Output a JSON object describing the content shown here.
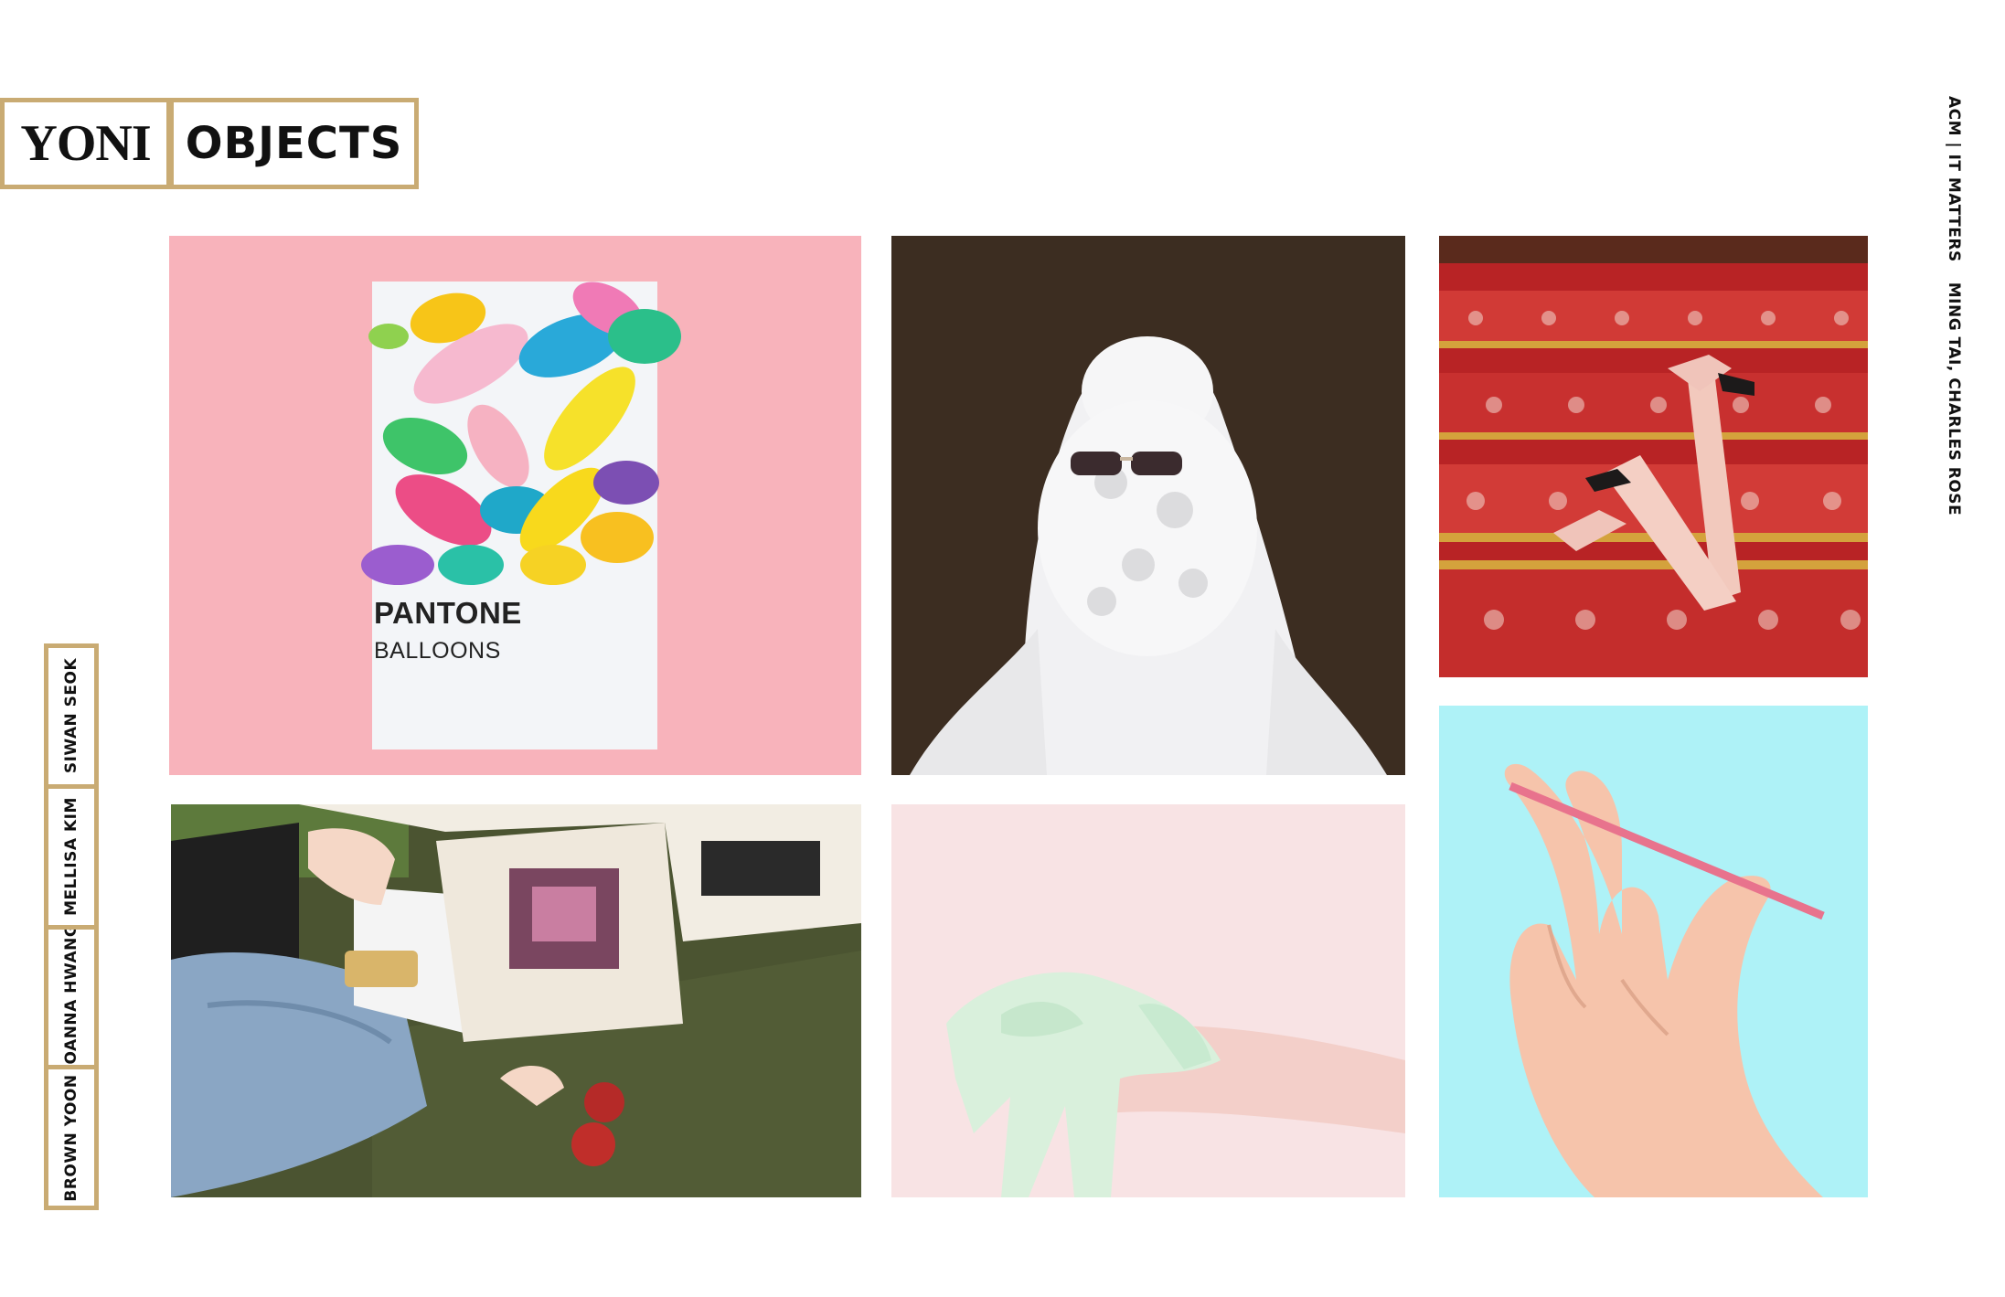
{
  "header": {
    "brand": "YONI",
    "section": "OBJECTS"
  },
  "authors": [
    "SIWAN SEOK",
    "MELLISA KIM",
    "JOANNA HWANG",
    "BROWN YOON"
  ],
  "credits": [
    "ACM | IT MATTERS",
    "MING TAI, CHARLES ROSE"
  ],
  "gallery": {
    "pantone_title": "PANTONE",
    "pantone_subtitle": "BALLOONS"
  },
  "colors": {
    "frame_gold": "#c9ab73",
    "balloons_bg": "#f8b3bb",
    "hand_bg": "#aef2f7",
    "slime_bg": "#f7e1e2",
    "theater_red": "#c82b2c"
  }
}
